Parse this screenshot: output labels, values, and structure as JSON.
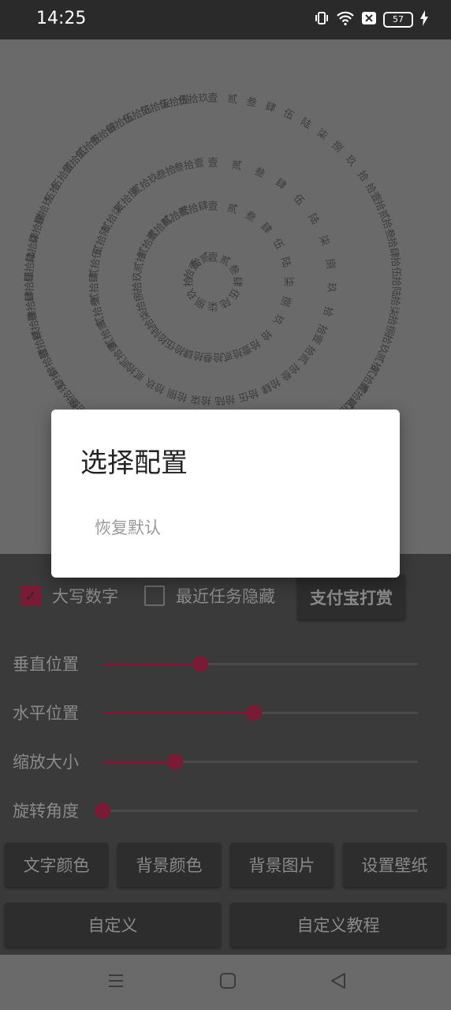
{
  "status_bar": {
    "time": "14:25",
    "battery": "57",
    "icons": [
      "vibrate-icon",
      "wifi-icon",
      "notification-x-icon",
      "battery-icon",
      "charging-bolt-icon"
    ]
  },
  "clock": {
    "rings": [
      [
        "壹",
        "贰",
        "叁",
        "肆",
        "伍",
        "陆",
        "柒",
        "捌",
        "玖",
        "拾",
        "拾壹",
        "拾贰"
      ],
      [
        "壹",
        "贰",
        "叁",
        "肆",
        "伍",
        "陆",
        "柒",
        "捌",
        "玖",
        "拾",
        "拾壹",
        "拾贰",
        "拾叁",
        "拾肆",
        "拾伍",
        "拾陆",
        "拾柒",
        "拾捌",
        "拾玖",
        "贰拾",
        "贰拾壹",
        "贰拾贰",
        "贰拾叁",
        "贰拾肆"
      ],
      [
        "壹",
        "贰",
        "叁",
        "肆",
        "伍",
        "陆",
        "柒",
        "捌",
        "玖",
        "拾",
        "拾壹",
        "拾贰",
        "拾叁",
        "拾肆",
        "拾伍",
        "拾陆",
        "拾柒",
        "拾捌",
        "拾玖",
        "贰拾",
        "贰拾壹",
        "贰拾贰",
        "贰拾叁",
        "贰拾肆",
        "贰拾伍",
        "贰拾陆",
        "贰拾柒",
        "贰拾捌",
        "贰拾玖",
        "叁拾",
        "叁拾壹"
      ],
      [
        "壹",
        "贰",
        "叁",
        "肆",
        "伍",
        "陆",
        "柒",
        "捌",
        "玖",
        "拾",
        "拾壹",
        "拾贰",
        "拾叁",
        "拾肆",
        "拾伍",
        "拾陆",
        "拾柒",
        "拾捌",
        "拾玖",
        "贰拾",
        "贰拾壹",
        "贰拾贰",
        "贰拾叁",
        "贰拾肆",
        "贰拾伍",
        "贰拾陆",
        "贰拾柒",
        "贰拾捌",
        "贰拾玖",
        "叁拾",
        "叁拾壹",
        "叁拾贰",
        "叁拾叁",
        "叁拾肆",
        "叁拾伍",
        "叁拾陆",
        "叁拾柒",
        "叁拾捌",
        "叁拾玖",
        "肆拾",
        "肆拾壹",
        "肆拾贰",
        "肆拾叁",
        "肆拾肆",
        "肆拾伍",
        "肆拾陆",
        "肆拾柒",
        "肆拾捌",
        "肆拾玖",
        "伍拾",
        "伍拾壹",
        "伍拾贰",
        "伍拾叁",
        "伍拾肆",
        "伍拾伍",
        "伍拾陆",
        "伍拾柒",
        "伍拾捌",
        "伍拾玖"
      ]
    ]
  },
  "controls": {
    "uppercase_numbers": {
      "label": "大写数字",
      "checked": true
    },
    "hide_recent_tasks": {
      "label": "最近任务隐藏",
      "checked": false
    },
    "alipay_button": "支付宝打赏",
    "sliders": [
      {
        "label": "垂直位置",
        "value": 0.31
      },
      {
        "label": "水平位置",
        "value": 0.48
      },
      {
        "label": "缩放大小",
        "value": 0.23
      },
      {
        "label": "旋转角度",
        "value": 0.0
      }
    ],
    "buttons_row1": [
      "文字颜色",
      "背景颜色",
      "背景图片",
      "设置壁纸"
    ],
    "buttons_row2": [
      "自定义",
      "自定义教程"
    ]
  },
  "dialog": {
    "title": "选择配置",
    "items": [
      "恢复默认"
    ]
  },
  "colors": {
    "accent": "#7a1a35",
    "preview_bg": "#6a6a6a",
    "controls_bg": "#3a3a3a"
  },
  "nav_bar": [
    "menu-icon",
    "home-square-icon",
    "back-triangle-icon"
  ]
}
